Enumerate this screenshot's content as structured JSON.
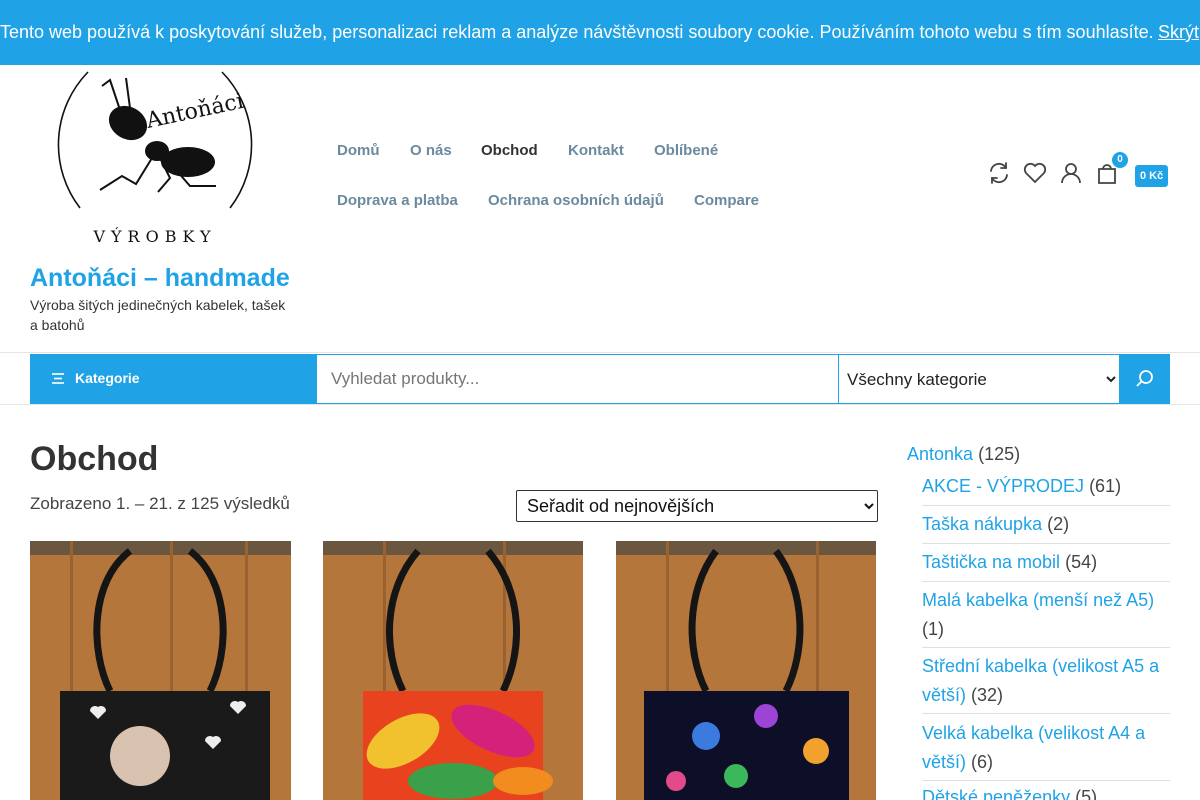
{
  "cookie_bar": {
    "text": "Tento web používá k poskytování služeb, personalizaci reklam a analýze návštěvnosti soubory cookie. Používáním tohoto webu s tím souhlasíte.",
    "hide_label": "Skrýt"
  },
  "site": {
    "logo_text_top": "Antoňáci",
    "logo_text_bottom": "VÝROBKY",
    "title": "Antoňáci – handmade",
    "description": "Výroba šitých jedinečných kabelek, tašek a batohů"
  },
  "menu": {
    "items": [
      {
        "label": "Domů"
      },
      {
        "label": "O nás"
      },
      {
        "label": "Obchod",
        "active": true
      },
      {
        "label": "Kontakt"
      },
      {
        "label": "Oblíbené"
      },
      {
        "label": "Doprava a platba"
      },
      {
        "label": "Ochrana osobních údajů"
      },
      {
        "label": "Compare"
      }
    ]
  },
  "header_icons": [
    "compare-icon",
    "heart-icon",
    "user-icon",
    "cart-icon"
  ],
  "cart": {
    "count": "0",
    "total": "0 Kč"
  },
  "search": {
    "category_button": "Kategorie",
    "placeholder": "Vyhledat produkty...",
    "category_selected": "Všechny kategorie"
  },
  "shop": {
    "title": "Obchod",
    "result_count": "Zobrazeno 1. – 21. z 125 výsledků",
    "orderby_selected": "Seřadit od nejnovějších"
  },
  "sidebar": {
    "parent": {
      "name": "Antonka",
      "count": "(125)"
    },
    "categories": [
      {
        "name": "AKCE - VÝPRODEJ",
        "count": "(61)"
      },
      {
        "name": "Taška nákupka",
        "count": "(2)"
      },
      {
        "name": "Taštička na mobil",
        "count": "(54)"
      },
      {
        "name": "Malá kabelka (menší než A5)",
        "count": "(1)"
      },
      {
        "name": "Střední kabelka (velikost A5 a větší)",
        "count": "(32)"
      },
      {
        "name": "Velká kabelka (velikost A4 a větší)",
        "count": "(6)"
      },
      {
        "name": "Dětské peněženky",
        "count": "(5)"
      }
    ]
  },
  "colors": {
    "accent": "#1fa3e6",
    "text": "#333333",
    "menu": "#6b8a9e"
  }
}
